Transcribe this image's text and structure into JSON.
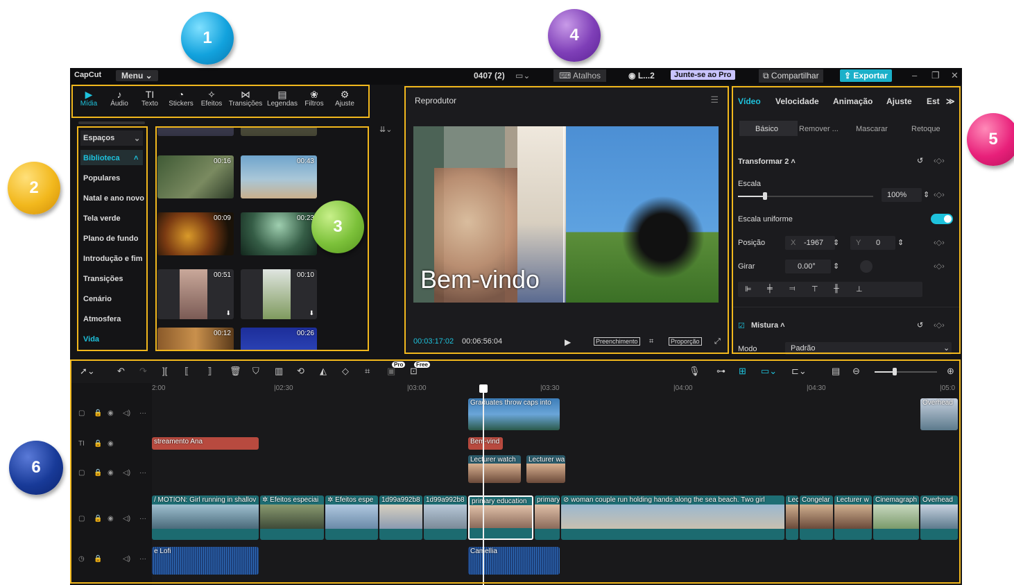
{
  "titlebar": {
    "logo": "CapCut",
    "menu": "Menu",
    "project": "0407 (2)",
    "shortcuts": "Atalhos",
    "user": "L...2",
    "join_pro": "Junte-se ao Pro",
    "share": "Compartilhar",
    "export": "Exportar"
  },
  "toolbar": [
    {
      "label": "Mídia",
      "icon": "media-icon",
      "glyph": "▶"
    },
    {
      "label": "Áudio",
      "icon": "audio-icon",
      "glyph": "♪"
    },
    {
      "label": "Texto",
      "icon": "text-icon",
      "glyph": "TI"
    },
    {
      "label": "Stickers",
      "icon": "sticker-icon",
      "glyph": "◔"
    },
    {
      "label": "Efeitos",
      "icon": "effects-icon",
      "glyph": "✧"
    },
    {
      "label": "Transições",
      "icon": "transitions-icon",
      "glyph": "⋈"
    },
    {
      "label": "Legendas",
      "icon": "captions-icon",
      "glyph": "▤"
    },
    {
      "label": "Filtros",
      "icon": "filters-icon",
      "glyph": "❀"
    },
    {
      "label": "Ajuste",
      "icon": "adjust-icon",
      "glyph": "⚙"
    }
  ],
  "leftnav": {
    "spaces": "Espaços",
    "items": [
      "Biblioteca",
      "Populares",
      "Natal e ano novo",
      "Tela verde",
      "Plano de fundo",
      "Introdução e fim",
      "Transições",
      "Cenário",
      "Atmosfera",
      "Vida"
    ]
  },
  "media": {
    "durations": [
      "00:16",
      "00:43",
      "00:09",
      "00:23",
      "00:51",
      "00:10",
      "00:12",
      "00:26"
    ]
  },
  "player": {
    "title": "Reprodutor",
    "caption": "Bem-vindo",
    "current_time": "00:03:17:02",
    "total_time": "00:06:56:04",
    "fill_btn": "Preenchimento",
    "ratio_btn": "Proporção"
  },
  "props": {
    "tabs": [
      "Vídeo",
      "Velocidade",
      "Animação",
      "Ajuste",
      "Est"
    ],
    "subtabs": [
      "Básico",
      "Remover ...",
      "Mascarar",
      "Retoque"
    ],
    "transform": "Transformar 2",
    "scale_label": "Escala",
    "scale_value": "100%",
    "scale_level": 0.2,
    "uniform_label": "Escala uniforme",
    "position_label": "Posição",
    "x_label": "X",
    "x_value": "-1967",
    "y_label": "Y",
    "y_value": "0",
    "rotate_label": "Girar",
    "rotate_value": "0.00°",
    "blend_label": "Mistura",
    "mode_label": "Modo",
    "mode_value": "Padrão"
  },
  "timeline": {
    "tags": {
      "pro": "Pro",
      "free": "Free"
    },
    "ruler": [
      "2:00",
      "|02:30",
      "|03:00",
      "|03:30",
      "|04:00",
      "|04:30",
      "|05:0"
    ],
    "clips": {
      "graduates": "Graduates throw caps into",
      "overhead_top": "Overhead",
      "text1": "streamento  Ana",
      "text2": "Bem-vind",
      "lecturer1": "Lecturer watch",
      "lecturer2": "Lecturer wa",
      "main": [
        "/ MOTION: Girl running in shallov",
        "Efeitos especiai",
        "Efeitos espe",
        "1d99a992b8",
        "1d99a992b8",
        "primary education",
        "primary",
        "woman couple run holding hands along the sea beach. Two girl",
        "Lec",
        "Congelar",
        "Lecturer w",
        "Cinemagraph",
        "Overhead"
      ],
      "audio1": "e Lofi",
      "audio2": "Camellia"
    }
  },
  "badges": [
    "1",
    "2",
    "3",
    "4",
    "5",
    "6"
  ],
  "colors": {
    "accent": "#1ec2dc",
    "frame": "#f2b81d"
  }
}
